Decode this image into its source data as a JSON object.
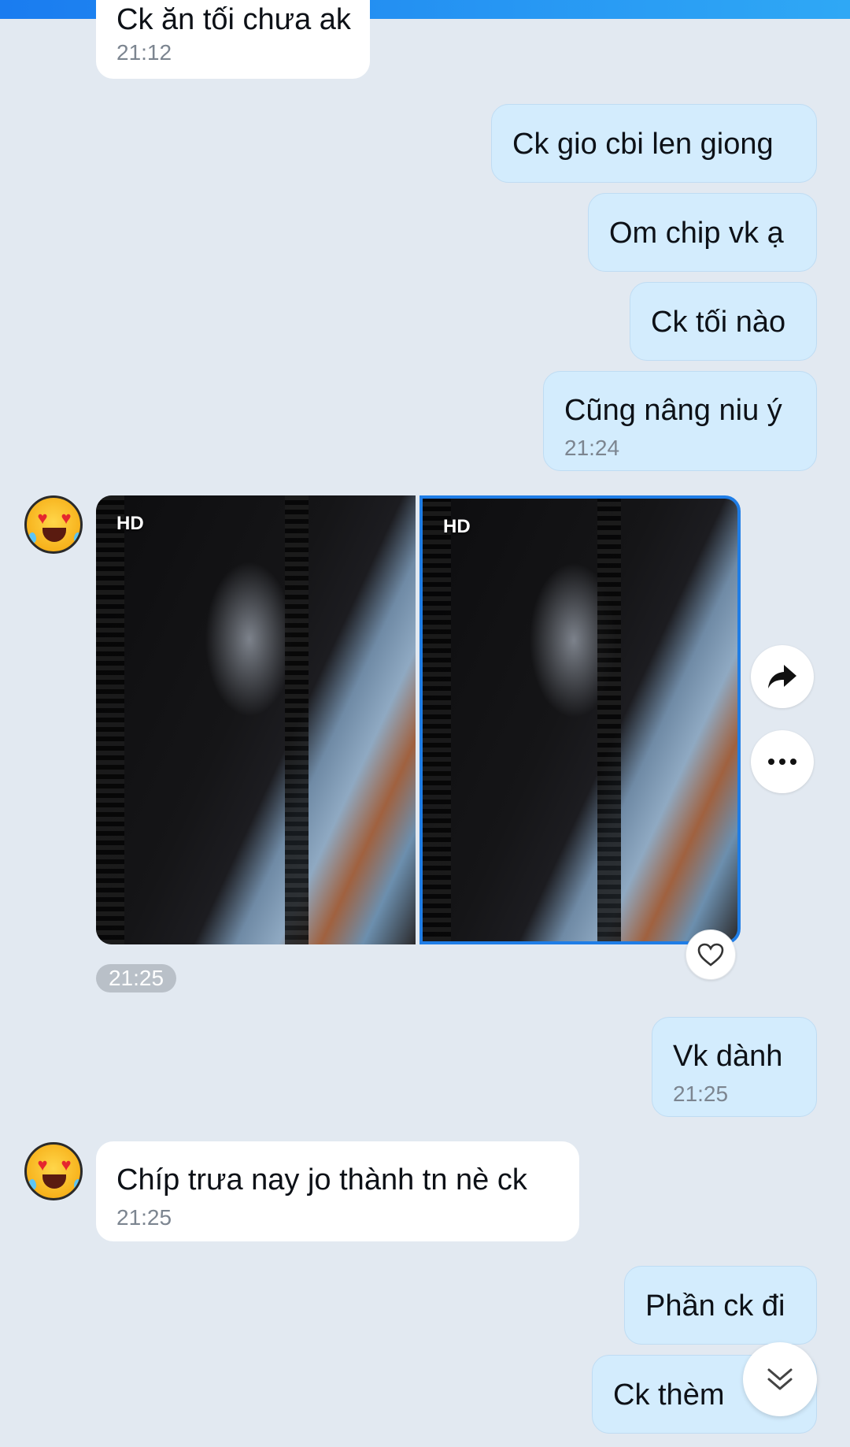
{
  "messages": [
    {
      "id": "m0",
      "direction": "incoming",
      "text": "Ck ăn tối chưa ak",
      "time": "21:12"
    },
    {
      "id": "m1",
      "direction": "outgoing",
      "text": "Ck gio cbi len giong"
    },
    {
      "id": "m2",
      "direction": "outgoing",
      "text": "Om chip vk ạ"
    },
    {
      "id": "m3",
      "direction": "outgoing",
      "text": "Ck tối nào"
    },
    {
      "id": "m4",
      "direction": "outgoing",
      "text": "Cũng nâng niu ý",
      "time": "21:24"
    },
    {
      "id": "m5",
      "direction": "incoming",
      "type": "photos",
      "badges": [
        "HD",
        "HD"
      ],
      "time": "21:25"
    },
    {
      "id": "m6",
      "direction": "outgoing",
      "text": "Vk dành",
      "time": "21:25"
    },
    {
      "id": "m7",
      "direction": "incoming",
      "text": "Chíp trưa nay jo thành tn nè ck",
      "time": "21:25"
    },
    {
      "id": "m8",
      "direction": "outgoing",
      "text": "Phần ck đi"
    },
    {
      "id": "m9",
      "direction": "outgoing",
      "text": "Ck thèm"
    }
  ],
  "icons": {
    "share": "share-arrow-icon",
    "more": "more-dots-icon",
    "react": "heart-icon",
    "scroll": "double-chevron-down-icon",
    "avatar": "emoji-avatar-icon"
  },
  "colors": {
    "background": "#e2e9f1",
    "incoming_bubble": "#ffffff",
    "outgoing_bubble": "#d3ecfd",
    "selected_border": "#1f7de6",
    "timestamp": "#7c8590"
  }
}
